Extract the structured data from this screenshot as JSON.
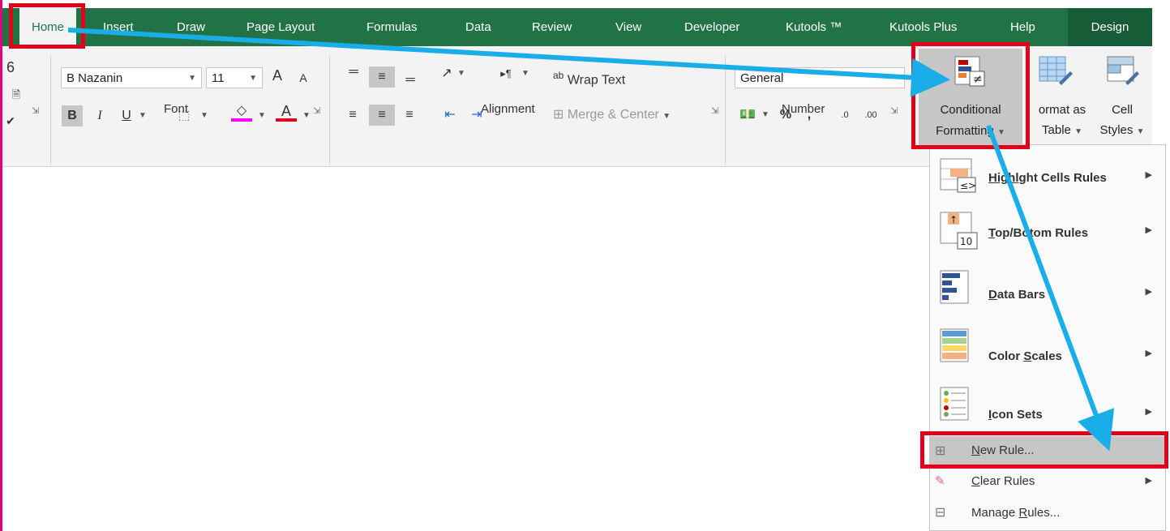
{
  "tabs": [
    {
      "label": "Home"
    },
    {
      "label": "Insert"
    },
    {
      "label": "Draw"
    },
    {
      "label": "Page Layout"
    },
    {
      "label": "Formulas"
    },
    {
      "label": "Data"
    },
    {
      "label": "Review"
    },
    {
      "label": "View"
    },
    {
      "label": "Developer"
    },
    {
      "label": "Kutools ™"
    },
    {
      "label": "Kutools Plus"
    },
    {
      "label": "Help"
    },
    {
      "label": "Design"
    }
  ],
  "font": {
    "name": "B Nazanin",
    "size": "11",
    "group_label": "Font",
    "bold": "B",
    "italic": "I",
    "underline": "U",
    "grow": "A",
    "shrink": "A",
    "font_color": "A"
  },
  "alignment": {
    "wrap_text": "Wrap Text",
    "merge_center": "Merge & Center",
    "group_label": "Alignment",
    "ab": "ab"
  },
  "number": {
    "format": "General",
    "percent": "%",
    "comma": ",",
    "group_label": "Number",
    "inc": ".0",
    "dec": ".00"
  },
  "styles": {
    "conditional_line1": "Conditional",
    "conditional_line2": "Formatting",
    "format_as_line1": "ormat as",
    "format_as_line2": "Table",
    "cell_line1": "Cell",
    "cell_line2": "Styles"
  },
  "menu": {
    "items": [
      {
        "label_a": "Highl",
        "label_b": "ght Cells Rules",
        "icon": "highlight-cells-icon"
      },
      {
        "label_pre": "",
        "label_u": "T",
        "label_post": "op/Bo",
        "label_tail": "tom Rules",
        "icon": "top-bottom-icon"
      },
      {
        "label_u": "D",
        "label_post": "ata Bars",
        "icon": "data-bars-icon"
      },
      {
        "label_pre": "Color ",
        "label_u": "S",
        "label_post": "cales",
        "icon": "color-scales-icon"
      },
      {
        "label_u": "I",
        "label_post": "con Sets",
        "icon": "icon-sets-icon"
      }
    ],
    "new_rule_u": "N",
    "new_rule_rest": "ew Rule...",
    "clear_rules_u": "C",
    "clear_rules_rest": "lear Rules",
    "manage_pre": "Manage ",
    "manage_u": "R",
    "manage_rest": "ules..."
  },
  "colors": {
    "tab_green": "#217346",
    "highlight_red": "#e3001b",
    "arrow_blue": "#1aaee8"
  }
}
